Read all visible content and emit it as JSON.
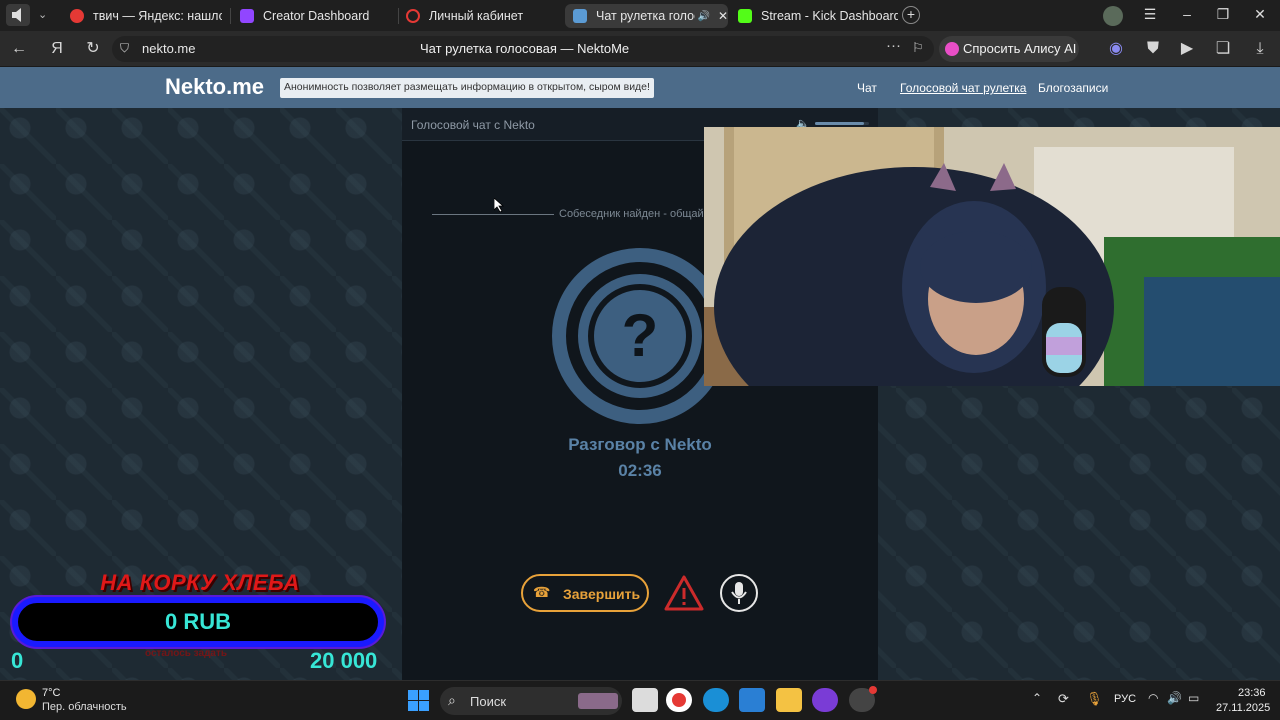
{
  "browser": {
    "tabs": [
      {
        "label": "твич — Яндекс: нашлось",
        "icon": "yandex-icon",
        "color": "#e53935"
      },
      {
        "label": "Creator Dashboard",
        "icon": "twitch-icon",
        "color": "#9146ff"
      },
      {
        "label": "Личный кабинет",
        "icon": "opera-ring-icon",
        "color": "#e53935"
      },
      {
        "label": "Чат рулетка голосо",
        "icon": "nekto-icon",
        "color": "#5b9bd5",
        "active": true
      },
      {
        "label": "Stream - Kick Dashboard",
        "icon": "kick-icon",
        "color": "#53fc18"
      }
    ],
    "url": "nekto.me",
    "page_title": "Чат рулетка голосовая — NektoMe",
    "alice_label": "Спросить Алису AI"
  },
  "site": {
    "logo": "Nekto.me",
    "tagline": "Анонимность позволяет размещать информацию в открытом, сыром виде!",
    "nav": [
      "Чат",
      "Голосовой чат рулетка",
      "Блогозаписи"
    ]
  },
  "chat": {
    "header": "Голосовой чат с Nekto",
    "status": "Собеседник найден - общай",
    "avatar_symbol": "?",
    "talking_with": "Разговор с Nekto",
    "timer": "02:36",
    "end_label": "Завершить",
    "volume_level": 0.9
  },
  "overlay": {
    "title": "НА КОРКУ ХЛЕБА",
    "amount": "0 RUB",
    "left_value": "0",
    "right_value": "20 000",
    "sub_label": "осталось задать"
  },
  "taskbar": {
    "temperature": "7°C",
    "weather": "Пер. облачность",
    "search_placeholder": "Поиск",
    "lang": "РУС",
    "time": "23:36",
    "date": "27.11.2025"
  }
}
